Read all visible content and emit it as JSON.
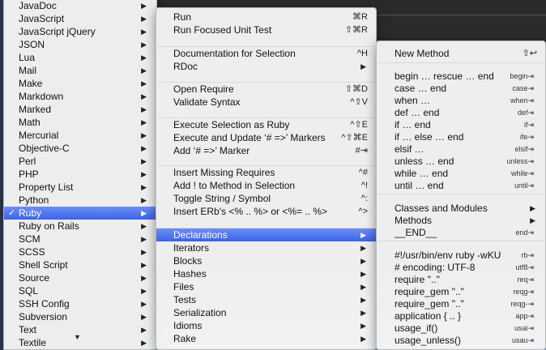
{
  "menu1": {
    "items": [
      {
        "label": "JavaDoc"
      },
      {
        "label": "JavaScript"
      },
      {
        "label": "JavaScript jQuery"
      },
      {
        "label": "JSON"
      },
      {
        "label": "Lua"
      },
      {
        "label": "Mail"
      },
      {
        "label": "Make"
      },
      {
        "label": "Markdown"
      },
      {
        "label": "Marked"
      },
      {
        "label": "Math"
      },
      {
        "label": "Mercurial"
      },
      {
        "label": "Objective-C"
      },
      {
        "label": "Perl"
      },
      {
        "label": "PHP"
      },
      {
        "label": "Property List"
      },
      {
        "label": "Python"
      },
      {
        "label": "Ruby",
        "checked": "✓"
      },
      {
        "label": "Ruby on Rails"
      },
      {
        "label": "SCM"
      },
      {
        "label": "SCSS"
      },
      {
        "label": "Shell Script"
      },
      {
        "label": "Source"
      },
      {
        "label": "SQL"
      },
      {
        "label": "SSH Config"
      },
      {
        "label": "Subversion"
      },
      {
        "label": "Text"
      },
      {
        "label": "Textile"
      }
    ],
    "selected_index": 16,
    "scroll_down_icon": "triangle-down-icon"
  },
  "menu2": {
    "items": [
      {
        "label": "Run",
        "shortcut": "⌘R"
      },
      {
        "label": "Run Focused Unit Test",
        "shortcut": "⇧⌘R"
      },
      {
        "label": "Documentation for Selection",
        "shortcut": "^H"
      },
      {
        "label": "RDoc",
        "arrow": "▶"
      },
      {
        "label": "Open Require",
        "shortcut": "⇧⌘D"
      },
      {
        "label": "Validate Syntax",
        "shortcut": "^⇧V"
      },
      {
        "label": "Execute Selection as Ruby",
        "shortcut": "^⇧E"
      },
      {
        "label": "Execute and Update ‘# =>’ Markers",
        "shortcut": "^⇧⌘E"
      },
      {
        "label": "Add ‘# =>’ Marker",
        "shortcut": "#⇥"
      },
      {
        "label": "Insert Missing Requires",
        "shortcut": "^#"
      },
      {
        "label": "Add ! to Method in Selection",
        "shortcut": "^!"
      },
      {
        "label": "Toggle String / Symbol",
        "shortcut": "^:"
      },
      {
        "label": "Insert ERb's <% .. %> or <%= .. %>",
        "shortcut": "^>"
      },
      {
        "label": "Declarations",
        "arrow": "▶"
      },
      {
        "label": "Iterators",
        "arrow": "▶"
      },
      {
        "label": "Blocks",
        "arrow": "▶"
      },
      {
        "label": "Hashes",
        "arrow": "▶"
      },
      {
        "label": "Files",
        "arrow": "▶"
      },
      {
        "label": "Tests",
        "arrow": "▶"
      },
      {
        "label": "Serialization",
        "arrow": "▶"
      },
      {
        "label": "Idioms",
        "arrow": "▶"
      },
      {
        "label": "Rake",
        "arrow": "▶"
      }
    ],
    "selected_index": 13
  },
  "menu3": {
    "items": [
      {
        "label": "New Method",
        "shortcut": "⇧↩"
      },
      {
        "label": "begin … rescue … end",
        "shortcut": "begin⇥"
      },
      {
        "label": "case … end",
        "shortcut": "case⇥"
      },
      {
        "label": "when …",
        "shortcut": "when⇥"
      },
      {
        "label": "def … end",
        "shortcut": "def⇥"
      },
      {
        "label": "if … end",
        "shortcut": "if⇥"
      },
      {
        "label": "if … else … end",
        "shortcut": "ife⇥"
      },
      {
        "label": "elsif …",
        "shortcut": "elsif⇥"
      },
      {
        "label": "unless … end",
        "shortcut": "unless⇥"
      },
      {
        "label": "while … end",
        "shortcut": "while⇥"
      },
      {
        "label": "until … end",
        "shortcut": "until⇥"
      },
      {
        "label": "Classes and Modules",
        "arrow": "▶"
      },
      {
        "label": "Methods",
        "arrow": "▶"
      },
      {
        "label": "__END__",
        "shortcut": "end⇥"
      },
      {
        "label": "#!/usr/bin/env ruby -wKU",
        "shortcut": "rb⇥"
      },
      {
        "label": "# encoding: UTF-8",
        "shortcut": "utf8⇥"
      },
      {
        "label": "require \"..\"",
        "shortcut": "req⇥"
      },
      {
        "label": "require_gem \"..\"",
        "shortcut": "reqg⇥"
      },
      {
        "label": "require_gem \"..\"",
        "shortcut": "reqg-⇥"
      },
      {
        "label": "application { .. }",
        "shortcut": "app⇥"
      },
      {
        "label": "usage_if()",
        "shortcut": "usai⇥"
      },
      {
        "label": "usage_unless()",
        "shortcut": "usau⇥"
      }
    ]
  }
}
